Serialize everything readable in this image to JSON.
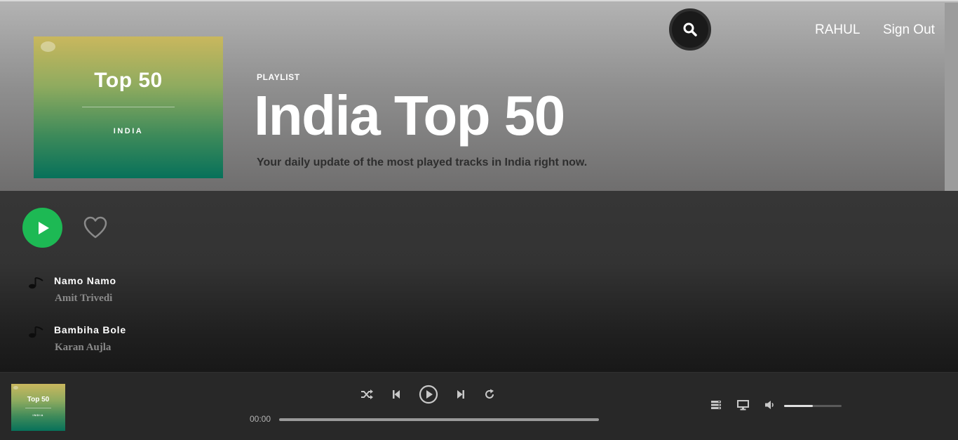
{
  "header": {
    "cover": {
      "title": "Top 50",
      "country": "INDIA"
    },
    "type_label": "PLAYLIST",
    "title": "India Top 50",
    "description": "Your daily update of the most played tracks in India right now.",
    "search_icon": "search-icon",
    "user_name": "RAHUL",
    "sign_out": "Sign Out"
  },
  "actions": {
    "play_icon": "play-icon",
    "like_icon": "heart-icon"
  },
  "tracks": [
    {
      "song": "Namo Namo",
      "artist": "Amit Trivedi",
      "icon": "music-note-icon"
    },
    {
      "song": "Bambiha Bole",
      "artist": "Karan Aujla",
      "icon": "music-note-icon"
    }
  ],
  "player": {
    "cover": {
      "title": "Top 50",
      "country": "INDIA"
    },
    "controls": [
      "shuffle-icon",
      "previous-icon",
      "play-icon",
      "next-icon",
      "repeat-icon"
    ],
    "current_time": "00:00",
    "progress_fraction": 0,
    "right_controls": [
      "queue-icon",
      "devices-icon",
      "volume-icon"
    ],
    "volume_fraction": 0.5
  },
  "colors": {
    "accent": "#1db954",
    "player_bg": "#282828"
  }
}
